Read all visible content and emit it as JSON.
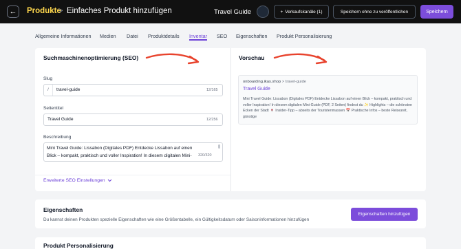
{
  "topbar": {
    "back_icon": "arrow-left-icon",
    "breadcrumb_root": "Produkte",
    "breadcrumb_separator": ">",
    "breadcrumb_page": "Einfaches Produkt hinzufügen",
    "product_name": "Travel Guide",
    "sales_channels_label": "Verkaufskanäle (1)",
    "sales_channels_icon": "plus-icon",
    "save_draft_label": "Speichern ohne zu veröffentlichen",
    "save_label": "Speichern",
    "accent_color": "#7c4ddb",
    "breadcrumb_color": "#ffd84d"
  },
  "tabs": [
    {
      "label": "Allgemeine Informationen",
      "active": false
    },
    {
      "label": "Medien",
      "active": false
    },
    {
      "label": "Datei",
      "active": false
    },
    {
      "label": "Produktdetails",
      "active": false
    },
    {
      "label": "Inventar",
      "active": true
    },
    {
      "label": "SEO",
      "active": false
    },
    {
      "label": "Eigenschaften",
      "active": false
    },
    {
      "label": "Produkt Personalisierung",
      "active": false
    }
  ],
  "seo": {
    "heading": "Suchmaschinenoptimierung (SEO)",
    "slug": {
      "label": "Slug",
      "prefix": "/",
      "value": "travel-guide",
      "counter": "12/165"
    },
    "page_title": {
      "label": "Seitentitel",
      "value": "Travel Guide",
      "counter": "12/256"
    },
    "description": {
      "label": "Beschreibung",
      "value": "Mini Travel Guide: Lissabon (Digitales PDF) Entdecke Lissabon auf einen Blick – kompakt, praktisch und voller Inspiration! In diesem digitalen Mini-Guide (PDF, 2 Seiten) findest du ✨ Highlights – die schönsten Ecken der Stadt 🍷 Insider-Tipp – abseits der Touristenmassen 📅 Praktische Infos – beste Reisezeit, günstige",
      "counter": "320/320"
    },
    "advanced_label": "Erweiterte SEO Einstellungen",
    "advanced_icon": "chevron-down-icon"
  },
  "preview": {
    "heading": "Vorschau",
    "domain": "onboarding.ikas.shop",
    "path": " > travel-guide",
    "title": "Travel Guide",
    "description": "Mini Travel Guide: Lissabon (Digitales PDF) Entdecke Lissabon auf einen Blick – kompakt, praktisch und voller Inspiration! In diesem digitalen Mini-Guide (PDF, 2 Seiten) findest du ✨ Highlights – die schönsten Ecken der Stadt 🍷 Insider-Tipp – abseits der Touristenmassen 📅 Praktische Infos – beste Reisezeit, günstige"
  },
  "annotations": {
    "arrow_color": "#e8432d"
  },
  "properties": {
    "title": "Eigenschaften",
    "description": "Du kannst deinen Produkten spezielle Eigenschaften wie eine Größentabelle, ein Gültigkeitsdatum oder Saisoninformationen hinzufügen",
    "button_label": "Eigenschaften hinzufügen"
  },
  "personalization": {
    "title": "Produkt Personalisierung"
  }
}
